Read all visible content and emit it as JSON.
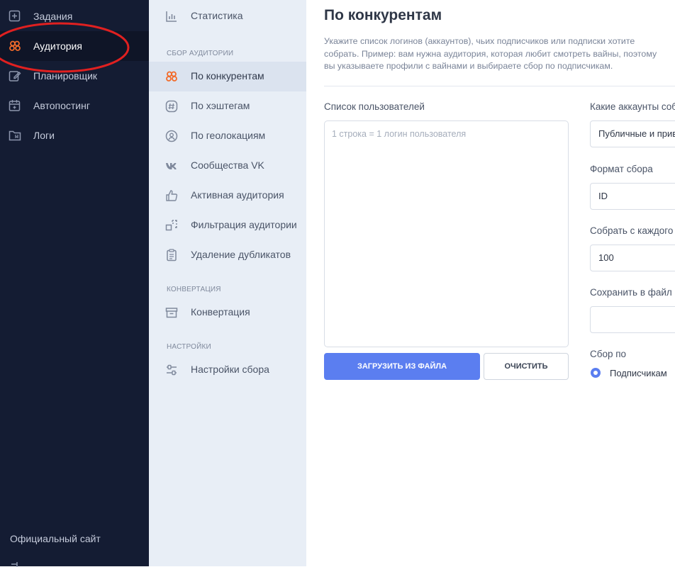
{
  "main_nav": {
    "items": [
      {
        "label": "Задания",
        "icon": "add-task-icon"
      },
      {
        "label": "Аудитория",
        "icon": "audience-icon",
        "active": true
      },
      {
        "label": "Планировщик",
        "icon": "edit-icon"
      },
      {
        "label": "Автопостинг",
        "icon": "calendar-add-icon"
      },
      {
        "label": "Логи",
        "icon": "folder-icon"
      }
    ],
    "site_link": "Официальный сайт"
  },
  "sub_nav": {
    "stats_label": "Статистика",
    "section_collect": "СБОР АУДИТОРИИ",
    "collect_items": [
      {
        "label": "По конкурентам",
        "icon": "audience-icon",
        "active": true
      },
      {
        "label": "По хэштегам",
        "icon": "hashtag-icon"
      },
      {
        "label": "По геолокациям",
        "icon": "geo-icon"
      },
      {
        "label": "Сообщества VK",
        "icon": "vk-icon"
      },
      {
        "label": "Активная аудитория",
        "icon": "thumbs-up-icon"
      },
      {
        "label": "Фильтрация аудитории",
        "icon": "filter-icon"
      },
      {
        "label": "Удаление дубликатов",
        "icon": "clipboard-icon"
      }
    ],
    "section_convert": "КОНВЕРТАЦИЯ",
    "convert_label": "Конвертация",
    "section_settings": "НАСТРОЙКИ",
    "settings_label": "Настройки сбора"
  },
  "main": {
    "title": "По конкурентам",
    "description": "Укажите список логинов (аккаунтов), чьих подписчиков или подписки хотите собрать. Пример: вам нужна аудитория, которая любит смотреть вайны, поэтому вы указываете профили с вайнами и выбираете сбор по подписчикам.",
    "users_label": "Список пользователей",
    "users_placeholder": "1 строка = 1 логин пользователя",
    "upload_button": "ЗАГРУЗИТЬ ИЗ ФАЙЛА",
    "clear_button": "ОЧИСТИТЬ",
    "accounts_label": "Какие аккаунты соб",
    "accounts_value": "Публичные и прив",
    "format_label": "Формат сбора",
    "format_value": "ID",
    "collect_each_label": "Собрать с каждого",
    "collect_each_value": "100",
    "save_label": "Сохранить в файл",
    "save_value": "",
    "collect_by_label": "Сбор по",
    "collect_by_option": "Подписчикам"
  },
  "colors": {
    "sidebar_dark": "#141c33",
    "sidebar_light": "#e8eef6",
    "accent": "#5b7ef0",
    "brand_orange": "#f26b2a",
    "annotation_red": "#e02020"
  }
}
